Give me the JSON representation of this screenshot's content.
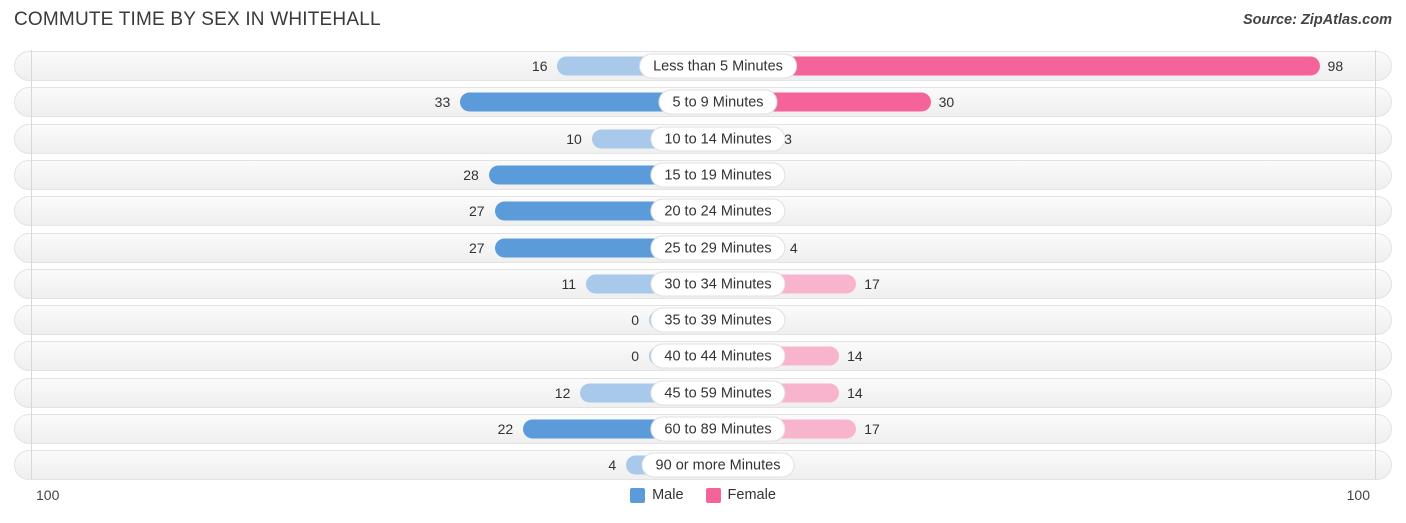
{
  "header": {
    "title": "COMMUTE TIME BY SEX IN WHITEHALL",
    "source": "Source: ZipAtlas.com"
  },
  "axis": {
    "left_end": "100",
    "right_end": "100",
    "max": 100
  },
  "legend": {
    "items": [
      {
        "label": "Male",
        "color": "#5b9bd9",
        "name": "legend-item-male"
      },
      {
        "label": "Female",
        "color": "#f4649a",
        "name": "legend-item-female"
      }
    ]
  },
  "colors": {
    "male_dark": "#5b9bd9",
    "male_light": "#a8c9ea",
    "female_dark": "#f4649a",
    "female_light": "#f9b4cd",
    "row_border": "#e3e3e3",
    "gridline": "#d8d8d8",
    "text": "#333333"
  },
  "chart_data": {
    "type": "bar",
    "orientation": "horizontal",
    "style": "diverging-bidirectional",
    "title": "COMMUTE TIME BY SEX IN WHITEHALL",
    "xlabel": "",
    "ylabel": "",
    "xlim": [
      100,
      100
    ],
    "grid": true,
    "legend_position": "bottom-center",
    "categories": [
      "Less than 5 Minutes",
      "5 to 9 Minutes",
      "10 to 14 Minutes",
      "15 to 19 Minutes",
      "20 to 24 Minutes",
      "25 to 29 Minutes",
      "30 to 34 Minutes",
      "35 to 39 Minutes",
      "40 to 44 Minutes",
      "45 to 59 Minutes",
      "60 to 89 Minutes",
      "90 or more Minutes"
    ],
    "series": [
      {
        "name": "Male",
        "color": "#5b9bd9",
        "direction": "left",
        "values": [
          16,
          33,
          10,
          28,
          27,
          27,
          11,
          0,
          0,
          12,
          22,
          4
        ]
      },
      {
        "name": "Female",
        "color": "#f4649a",
        "direction": "right",
        "values": [
          98,
          30,
          3,
          0,
          0,
          4,
          17,
          0,
          14,
          14,
          17,
          0
        ]
      }
    ]
  },
  "rows": [
    {
      "label": "Less than 5 Minutes",
      "male": "16",
      "female": "98",
      "male_value": 16,
      "female_value": 98
    },
    {
      "label": "5 to 9 Minutes",
      "male": "33",
      "female": "30",
      "male_value": 33,
      "female_value": 30
    },
    {
      "label": "10 to 14 Minutes",
      "male": "10",
      "female": "3",
      "male_value": 10,
      "female_value": 3
    },
    {
      "label": "15 to 19 Minutes",
      "male": "28",
      "female": "0",
      "male_value": 28,
      "female_value": 0
    },
    {
      "label": "20 to 24 Minutes",
      "male": "27",
      "female": "0",
      "male_value": 27,
      "female_value": 0
    },
    {
      "label": "25 to 29 Minutes",
      "male": "27",
      "female": "4",
      "male_value": 27,
      "female_value": 4
    },
    {
      "label": "30 to 34 Minutes",
      "male": "11",
      "female": "17",
      "male_value": 11,
      "female_value": 17
    },
    {
      "label": "35 to 39 Minutes",
      "male": "0",
      "female": "0",
      "male_value": 0,
      "female_value": 0
    },
    {
      "label": "40 to 44 Minutes",
      "male": "0",
      "female": "14",
      "male_value": 0,
      "female_value": 14
    },
    {
      "label": "45 to 59 Minutes",
      "male": "12",
      "female": "14",
      "male_value": 12,
      "female_value": 14
    },
    {
      "label": "60 to 89 Minutes",
      "male": "22",
      "female": "17",
      "male_value": 22,
      "female_value": 17
    },
    {
      "label": "90 or more Minutes",
      "male": "4",
      "female": "0",
      "male_value": 4,
      "female_value": 0
    }
  ]
}
